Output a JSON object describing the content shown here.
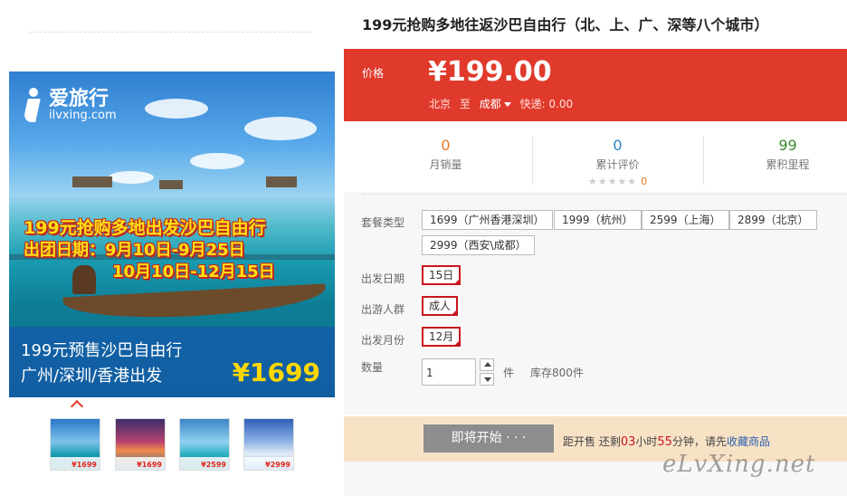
{
  "product": {
    "title": "199元抢购多地往返沙巴自由行（北、上、广、深等八个城市）"
  },
  "hero": {
    "logo_text": "爱旅行",
    "logo_domain": "ilvxing.com",
    "promo_line1": "199元抢购多地出发沙巴自由行",
    "promo_line2": "出团日期：9月10日-9月25日",
    "promo_line3": "10月10日-12月15日",
    "bar_line1": "199元预售沙巴自由行",
    "bar_line2": "广州/深圳/香港出发",
    "bar_price": "¥1699"
  },
  "thumbnails": [
    {
      "price": "¥1699"
    },
    {
      "price": "¥1699"
    },
    {
      "price": "¥2599"
    },
    {
      "price": "¥2999"
    }
  ],
  "price": {
    "label": "价格",
    "value": "¥199.00",
    "from": "北京",
    "to_word": "至",
    "to": "成都",
    "shipping": "快递: 0.00"
  },
  "stats": {
    "monthly_sales": {
      "value": "0",
      "label": "月销量"
    },
    "reviews": {
      "value": "0",
      "label": "累计评价",
      "stars": "★★★★★",
      "score": "0"
    },
    "points": {
      "value": "99",
      "label": "累积里程"
    }
  },
  "options": {
    "package_label": "套餐类型",
    "packages": [
      "1699（广州香港深圳）",
      "1999（杭州）",
      "2599（上海）",
      "2899（北京）",
      "2999（西安\\成都）"
    ],
    "date_label": "出发日期",
    "date_value": "15日",
    "crowd_label": "出游人群",
    "crowd_value": "成人",
    "month_label": "出发月份",
    "month_value": "12月",
    "qty_label": "数量",
    "qty_value": "1",
    "unit": "件",
    "stock": "库存800件"
  },
  "action": {
    "button": "即将开始 · · ·",
    "cd_prefix": "距开售 还剩",
    "hours": "03",
    "hours_unit": "小时",
    "minutes": "55",
    "minutes_unit": "分钟，请先",
    "fav_link": "收藏商品"
  },
  "watermark": "eLvXing.net",
  "colors": {
    "accent_red": "#e03a2c",
    "selected_border": "#c8161d",
    "action_bar": "#f8e2c6"
  }
}
